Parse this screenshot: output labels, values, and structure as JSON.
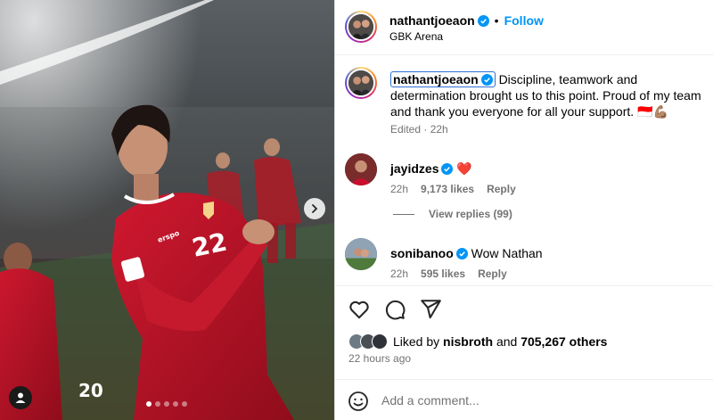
{
  "post": {
    "author": "nathantjoeaon",
    "follow_label": "Follow",
    "separator": "•",
    "location": "GBK Arena",
    "caption_text": "Discipline, teamwork and determination brought us to this point. Proud of my team and thank you everyone for all your support. 🇮🇩💪🏽",
    "edited_label": "Edited · 22h"
  },
  "media": {
    "carousel_count": 5,
    "active_index": 0,
    "jersey_number": "22",
    "sponsor_text": "erspo"
  },
  "comments": [
    {
      "user": "jayidzes",
      "text": "❤️",
      "time": "22h",
      "likes": "9,173 likes",
      "reply": "Reply"
    },
    {
      "user": "sonibanoo",
      "text": "Wow Nathan",
      "time": "22h",
      "likes": "595 likes",
      "reply": "Reply"
    }
  ],
  "view_replies": "View replies (99)",
  "engagement": {
    "liked_prefix": "Liked by",
    "liked_user": "nisbroth",
    "liked_and": "and",
    "liked_others": "705,267 others",
    "time_ago": "22 hours ago"
  },
  "composer": {
    "placeholder": "Add a comment..."
  },
  "icons": [
    "verified-badge-icon",
    "heart-icon",
    "comment-icon",
    "share-icon",
    "emoji-icon",
    "user-tag-icon",
    "chevron-right-icon"
  ],
  "colors": {
    "accent": "#0095f6",
    "muted": "#737373",
    "jersey": "#c8102e"
  }
}
